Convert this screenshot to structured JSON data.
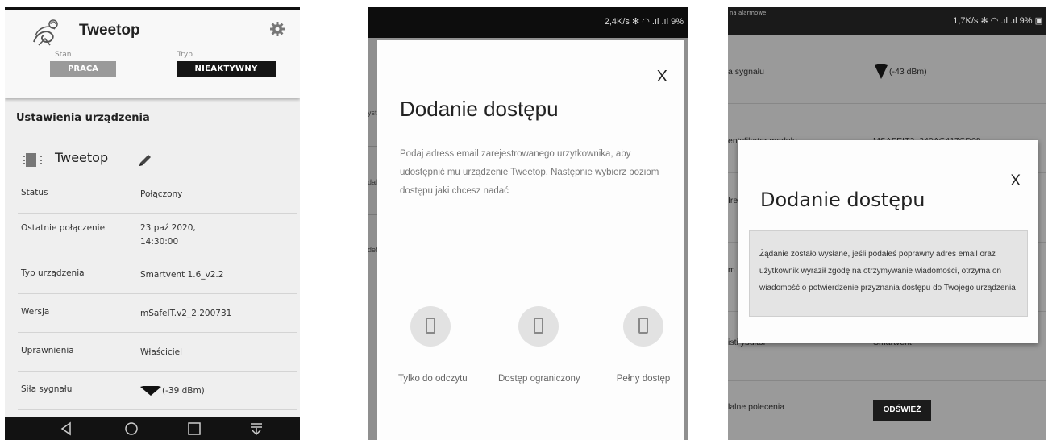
{
  "panel1": {
    "app_name": "Tweetop",
    "stan_label": "Stan",
    "tryb_label": "Tryb",
    "stan_value": "PRACA",
    "tryb_value": "NIEAKTYWNY",
    "section_title": "Ustawienia urządzenia",
    "device_name": "Tweetop",
    "rows": [
      {
        "key": "Status",
        "value": "Połączony"
      },
      {
        "key": "Ostatnie połączenie",
        "value": "23 paź 2020,",
        "value2": "14:30:00"
      },
      {
        "key": "Typ urządzenia",
        "value": "Smartvent 1.6_v2.2"
      },
      {
        "key": "Wersja",
        "value": "mSafeIT.v2_2.200731"
      },
      {
        "key": "Uprawnienia",
        "value": "Właściciel"
      },
      {
        "key": "Siła sygnału",
        "value": "(-39 dBm)"
      }
    ],
    "icons": [
      "tweetop-logo-icon",
      "gear-icon",
      "device-chip-icon",
      "pencil-icon",
      "signal-icon",
      "back-icon",
      "home-icon",
      "recents-icon",
      "notifications-icon"
    ]
  },
  "panel2": {
    "status_text": "2,4K/s ✻ ◠ .ıl .ıl 9%",
    "behind_labels": [
      "ystr",
      "dalı",
      "defi"
    ],
    "dialog_title": "Dodanie dostępu",
    "close_label": "X",
    "description": "Podaj adress email zarejestrowanego urzytkownika, aby udostępnić mu urządzenie Tweetop. Następnie wybierz poziom dostępu jaki chcesz nadać",
    "options": [
      {
        "label": "Tylko do odczytu"
      },
      {
        "label": "Dostęp ograniczony"
      },
      {
        "label": "Pełny dostęp"
      }
    ]
  },
  "panel3": {
    "status_left": "na alarmowe",
    "status_right": "1,7K/s ✻ ◠ .ıl .ıl 9% ▣",
    "behind_rows": [
      {
        "key": "a sygnału",
        "value": "(-43 dBm)"
      },
      {
        "key": "entyfikator modułu",
        "value": "MSAFEIT2_240AC417CD08"
      },
      {
        "key": "Ires",
        "value": ""
      },
      {
        "key": "m",
        "value": ""
      },
      {
        "key": "isti ybultor",
        "value": "Smartvent"
      },
      {
        "key": "lalne polecenia",
        "value": ""
      }
    ],
    "refresh_label": "ODŚWIEŻ",
    "dialog_title": "Dodanie dostępu",
    "close_label": "X",
    "message": "Żądanie zostało wysłane, jeśli podałeś poprawny adres email oraz użytkownik wyraził zgodę na otrzymywanie wiadomości, otrzyma on wiadomość o potwierdzenie przyznania dostępu do Twojego urządzenia"
  }
}
